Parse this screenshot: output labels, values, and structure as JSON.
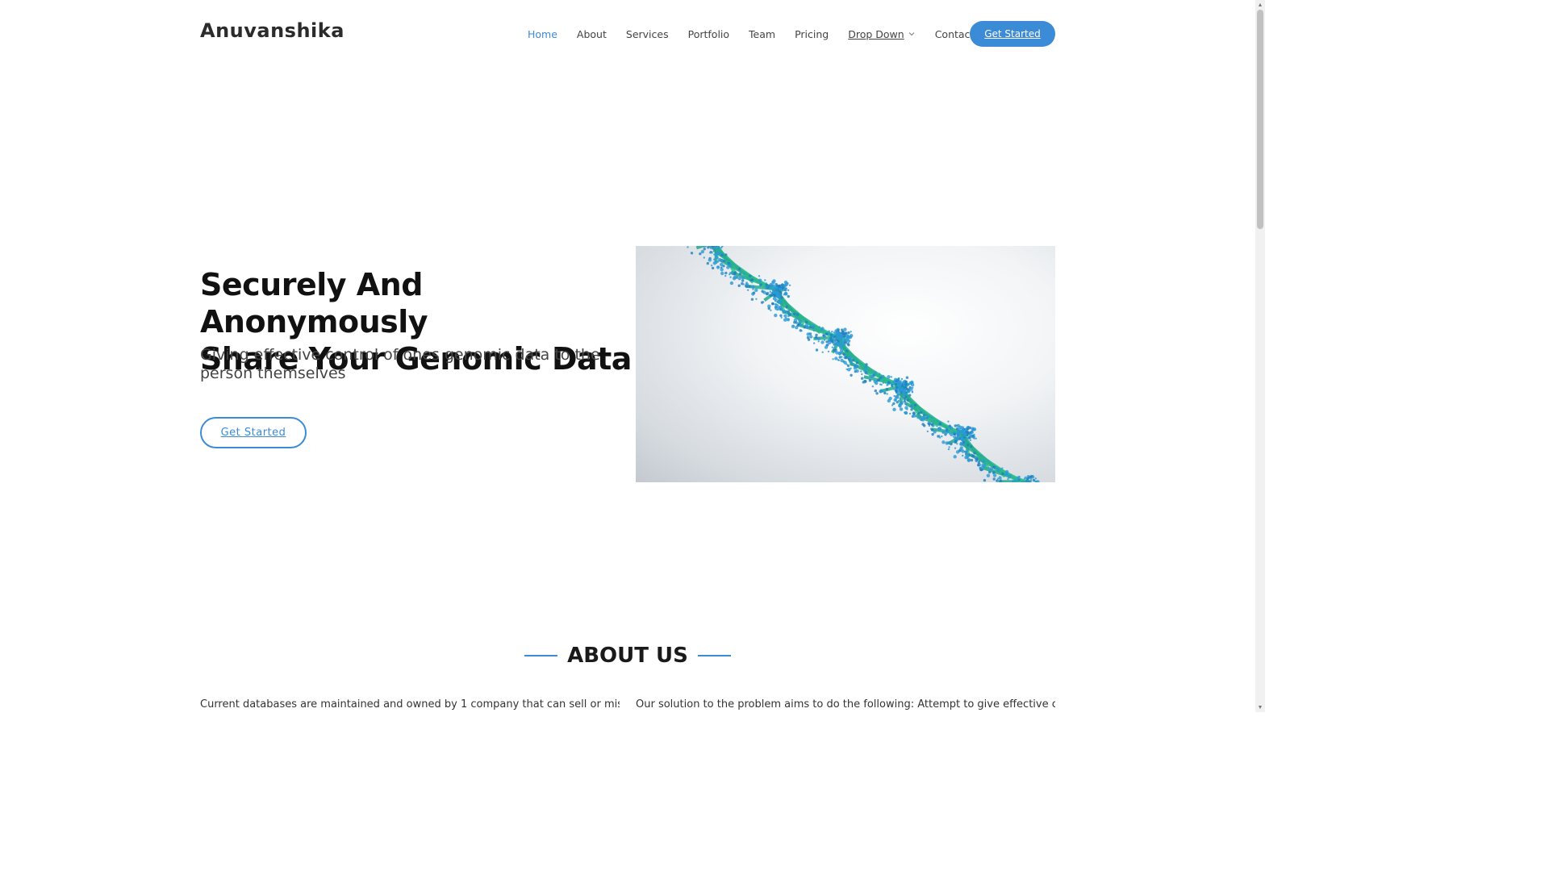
{
  "header": {
    "logo": "Anuvanshika",
    "nav": [
      {
        "label": "Home",
        "active": true
      },
      {
        "label": "About"
      },
      {
        "label": "Services"
      },
      {
        "label": "Portfolio"
      },
      {
        "label": "Team"
      },
      {
        "label": "Pricing"
      },
      {
        "label": "Drop Down",
        "dropdown": true
      },
      {
        "label": "Contact"
      }
    ],
    "cta_label": "Get Started"
  },
  "hero": {
    "title_line1": "Securely And Anonymously",
    "title_line2": "Share Your Genomic Data",
    "subtitle": "Giving effective control of ones genomic data to the person themselves",
    "button_label": "Get Started",
    "image_icon": "dna-helix-image"
  },
  "about": {
    "title": "ABOUT US",
    "left_text": "Current databases are maintained and owned by 1 company that can sell or misuse our",
    "right_text": "Our solution to the problem aims to do the following: Attempt to give effective control"
  },
  "colors": {
    "accent": "#3b8bd6",
    "text_dark": "#111111",
    "text_body": "#444444"
  }
}
